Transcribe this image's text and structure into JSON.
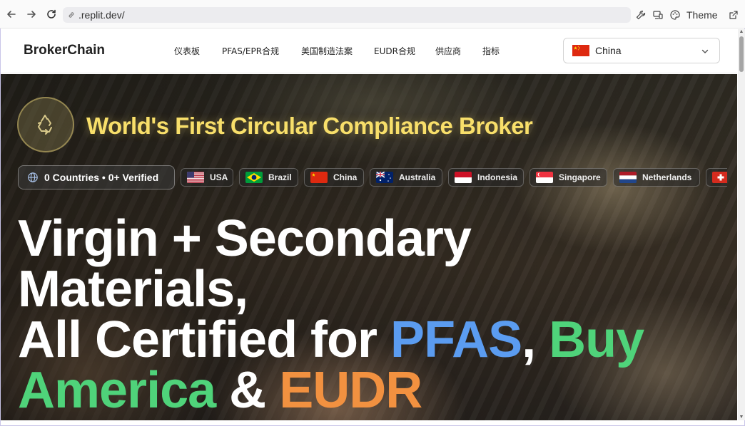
{
  "browser": {
    "url": ".replit.dev/",
    "theme_label": "Theme"
  },
  "header": {
    "logo": "BrokerChain",
    "nav": [
      "仪表板",
      "PFAS/EPR合规",
      "美国制造法案",
      "EUDR合规",
      "供应商",
      "指标"
    ],
    "country_select": {
      "selected": "China",
      "flag": "china"
    }
  },
  "hero": {
    "tagline": "World's First Circular Compliance Broker",
    "stats": "0 Countries • 0+ Verified",
    "countries": [
      "USA",
      "Brazil",
      "China",
      "Australia",
      "Indonesia",
      "Singapore",
      "Netherlands"
    ],
    "headline": {
      "line1": "Virgin + Secondary",
      "line2": "Materials,",
      "line3_prefix": "All Certified for ",
      "pfas": "PFAS",
      "comma": ", ",
      "buy": "Buy",
      "america": "America",
      "amp": " & ",
      "eudr": "EUDR"
    }
  },
  "colors": {
    "tagline": "#f8df6a",
    "pfas": "#5b9cf0",
    "buy_america": "#4fd37a",
    "eudr": "#f29140"
  },
  "icons": {
    "back": "arrow-left-icon",
    "forward": "arrow-right-icon",
    "reload": "reload-icon",
    "site_info": "site-info-icon",
    "recycle": "recycle-icon",
    "globe": "globe-icon"
  }
}
